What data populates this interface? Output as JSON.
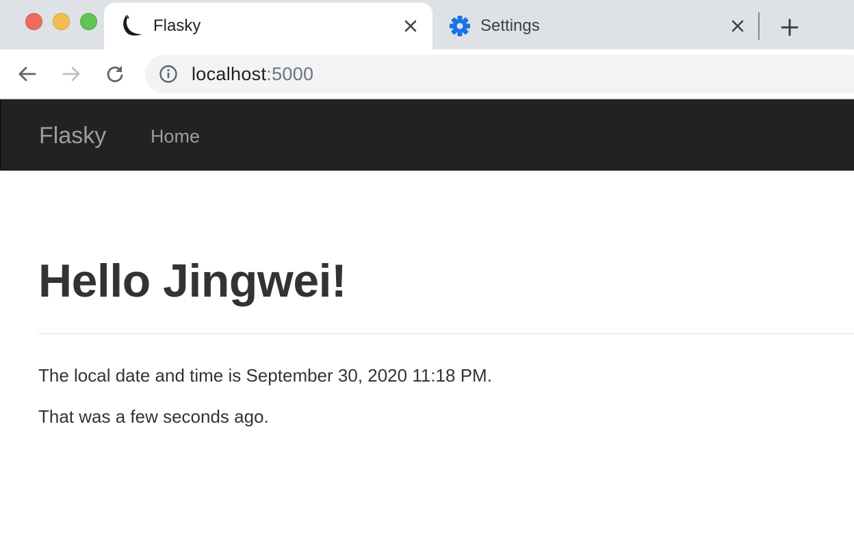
{
  "browser": {
    "tabs": [
      {
        "title": "Flasky",
        "icon": "flask-horn-icon",
        "active": true
      },
      {
        "title": "Settings",
        "icon": "gear-icon",
        "active": false
      }
    ],
    "address": {
      "host": "localhost",
      "port": ":5000"
    }
  },
  "navbar": {
    "brand": "Flasky",
    "links": [
      "Home"
    ]
  },
  "main": {
    "heading": "Hello Jingwei!",
    "datetime_line": "The local date and time is September 30, 2020 11:18 PM.",
    "ago_line": "That was a few seconds ago."
  },
  "colors": {
    "tabstrip_bg": "#dee1e6",
    "navbar_bg": "#222222",
    "navbar_text": "#9d9d9d",
    "settings_icon": "#1a73e8",
    "text": "#333333"
  }
}
